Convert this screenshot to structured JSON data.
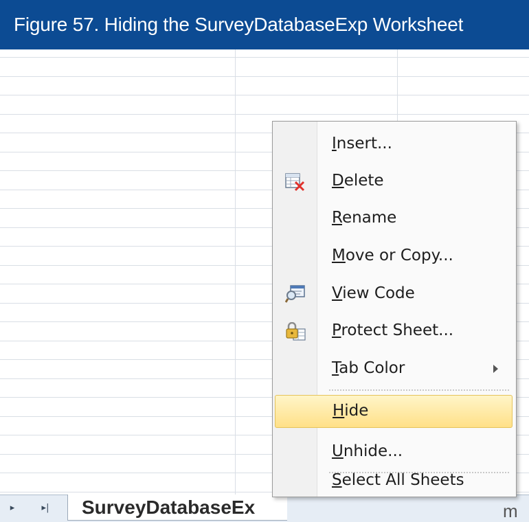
{
  "caption": "Figure 57. Hiding the SurveyDatabaseExp Worksheet",
  "sheet_tabs": {
    "nav_first": "▸",
    "nav_last": "▸|",
    "active_tab": "SurveyDatabaseEx",
    "next_tab_fragment": "m"
  },
  "context_menu": {
    "items": [
      {
        "label": "Insert...",
        "mnemonic": "I",
        "icon": null
      },
      {
        "label": "Delete",
        "mnemonic": "D",
        "icon": "delete-sheet-icon"
      },
      {
        "label": "Rename",
        "mnemonic": "R",
        "icon": null
      },
      {
        "label": "Move or Copy...",
        "mnemonic": "M",
        "icon": null
      },
      {
        "label": "View Code",
        "mnemonic": "V",
        "icon": "view-code-icon"
      },
      {
        "label": "Protect Sheet...",
        "mnemonic": "P",
        "icon": "protect-sheet-icon"
      },
      {
        "label": "Tab Color",
        "mnemonic": "T",
        "icon": null,
        "submenu": true
      },
      {
        "label": "Hide",
        "mnemonic": "H",
        "icon": null,
        "highlighted": true
      },
      {
        "label": "Unhide...",
        "mnemonic": "U",
        "icon": null
      },
      {
        "label": "Select All Sheets",
        "mnemonic": "S",
        "icon": null
      }
    ]
  },
  "colors": {
    "caption_bg": "#0c4b93",
    "highlight": "#ffe088",
    "gridline": "#d9dee5"
  }
}
